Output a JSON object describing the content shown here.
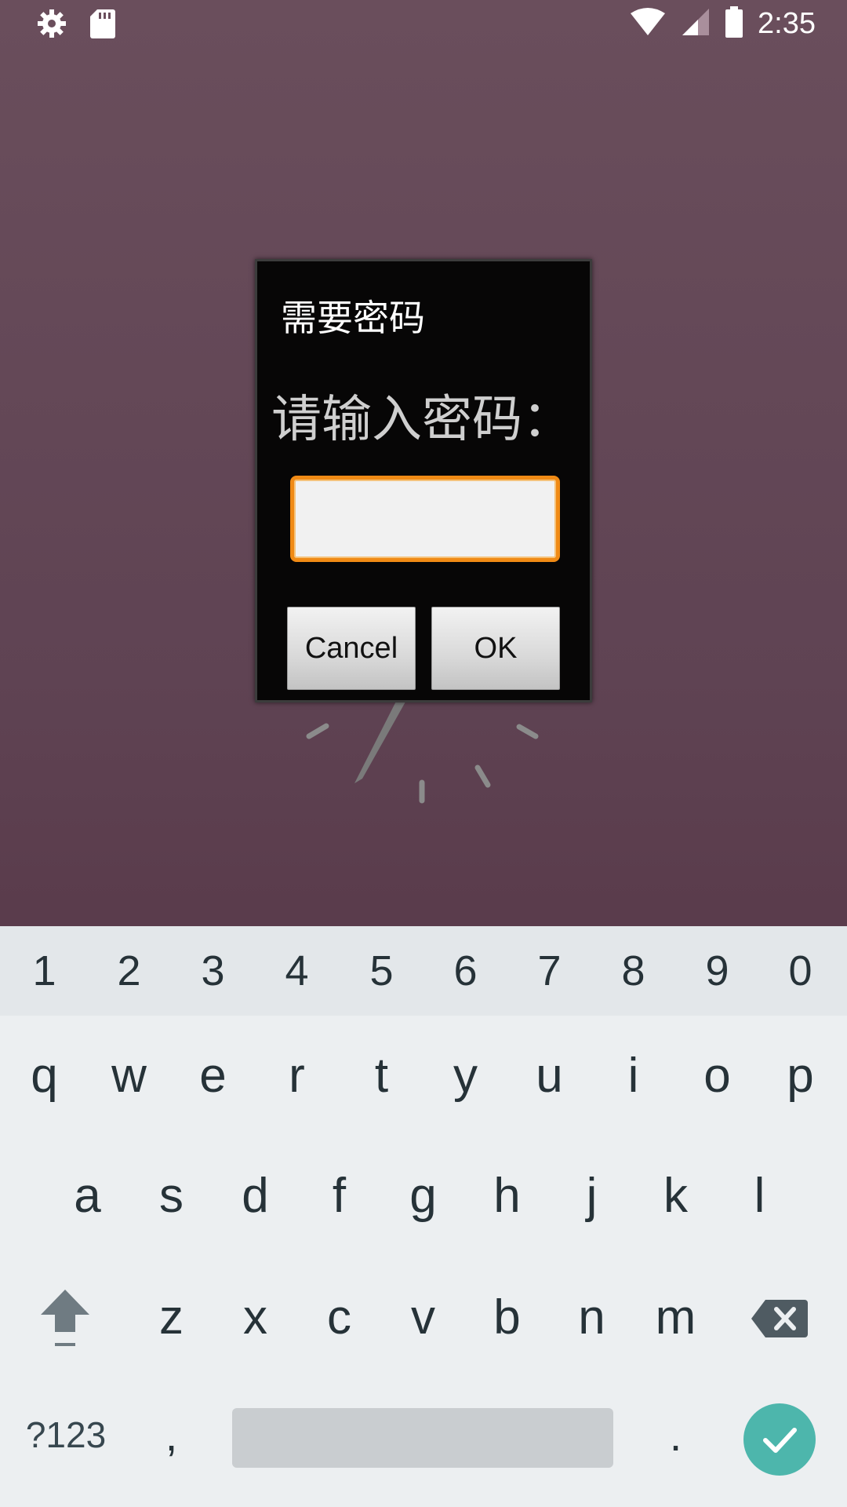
{
  "status_bar": {
    "time": "2:35",
    "icons": [
      "settings-icon",
      "sd-card-icon",
      "wifi-icon",
      "signal-icon",
      "battery-icon"
    ]
  },
  "dialog": {
    "title": "需要密码",
    "message": "请输入密码：",
    "input_value": "",
    "cancel_label": "Cancel",
    "ok_label": "OK"
  },
  "keyboard": {
    "numbers": [
      "1",
      "2",
      "3",
      "4",
      "5",
      "6",
      "7",
      "8",
      "9",
      "0"
    ],
    "row1": [
      "q",
      "w",
      "e",
      "r",
      "t",
      "y",
      "u",
      "i",
      "o",
      "p"
    ],
    "row2": [
      "a",
      "s",
      "d",
      "f",
      "g",
      "h",
      "j",
      "k",
      "l"
    ],
    "row3": [
      "z",
      "x",
      "c",
      "v",
      "b",
      "n",
      "m"
    ],
    "symbols_label": "?123",
    "comma_label": ",",
    "period_label": "."
  },
  "colors": {
    "accent_input_border": "#f08a15",
    "enter_button": "#4db6ac",
    "background_top": "#6a4e5c",
    "background_bottom": "#4e2a3a"
  }
}
